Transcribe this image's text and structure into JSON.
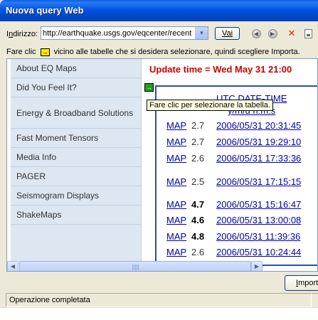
{
  "window": {
    "title": "Nuova query Web"
  },
  "address": {
    "label_prefix": "I",
    "label_underlined": "n",
    "label_rest": "dirizzo:",
    "value": "http://earthquake.usgs.gov/eqcenter/recent",
    "go_label": "Vai"
  },
  "instruction": {
    "before": "Fare clic",
    "after": "vicino alle tabelle che si desidera selezionare, quindi scegliere Importa."
  },
  "sidebar": {
    "items": [
      {
        "label": "About EQ Maps"
      },
      {
        "label": "Did You Feel It?"
      },
      {
        "label": "Energy & Broadband Solutions"
      },
      {
        "label": "Fast Moment Tensors"
      },
      {
        "label": "Media Info"
      },
      {
        "label": "PAGER"
      },
      {
        "label": "Seismogram Displays"
      },
      {
        "label": "ShakeMaps"
      }
    ]
  },
  "page": {
    "update_time": "Update time = Wed May 31 21:00",
    "tooltip": "Fare clic per selezionare la tabella.",
    "table": {
      "header_line1": "UTC DATE-TIME",
      "header_line2": "y/m/d h:m:s",
      "rows": [
        {
          "map": "MAP",
          "mag": "2.7",
          "datetime": "2006/05/31 20:31:45",
          "bold": false
        },
        {
          "map": "MAP",
          "mag": "2.7",
          "datetime": "2006/05/31 19:29:10",
          "bold": false
        },
        {
          "map": "MAP",
          "mag": "2.6",
          "datetime": "2006/05/31 17:33:36",
          "bold": false
        },
        {
          "map": "MAP",
          "mag": "2.5",
          "datetime": "2006/05/31 17:15:15",
          "bold": false
        },
        {
          "map": "MAP",
          "mag": "4.7",
          "datetime": "2006/05/31 15:16:47",
          "bold": true
        },
        {
          "map": "MAP",
          "mag": "4.6",
          "datetime": "2006/05/31 13:00:08",
          "bold": true
        },
        {
          "map": "MAP",
          "mag": "4.8",
          "datetime": "2006/05/31 11:39:36",
          "bold": true
        },
        {
          "map": "MAP",
          "mag": "2.6",
          "datetime": "2006/05/31 10:24:44",
          "bold": false
        }
      ]
    }
  },
  "buttons": {
    "import_underlined": "I",
    "import_rest": "mport"
  },
  "status": {
    "text": "Operazione completata"
  },
  "colors": {
    "title_bar": "#0054e3",
    "update_text": "#cc0000",
    "link": "#0000aa",
    "sidebar_bg": "#dce7f2"
  },
  "icons": [
    "back-icon",
    "forward-icon",
    "stop-icon",
    "options-icon",
    "select-table-icon"
  ]
}
